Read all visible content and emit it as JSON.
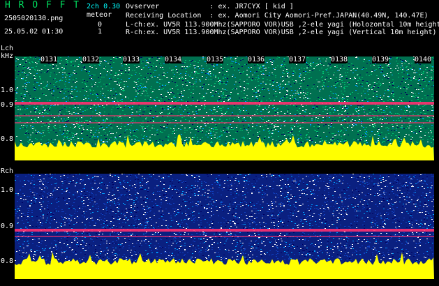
{
  "header": {
    "title": "H R O F F T",
    "channel_mode": "2ch 0.30",
    "meteor_label": "meteor",
    "filename": "2505020130.png",
    "datetime": "25.05.02 01:30",
    "meteor_count_l": "0",
    "meteor_count_r": "1",
    "observer_label": "Ovserver",
    "observer_value": ": ex. JR7CYX [ kid ]",
    "location_label": "Receiving Location",
    "location_value": ": ex. Aomori City Aomori-Pref.JAPAN(40.49N, 140.47E)",
    "lch_line": "L-ch:ex. UV5R 113.900Mhz(SAPPORO VOR)USB ,2-ele yagi (Holozontal 10m height)",
    "rch_line": "R-ch:ex. UV5R 113.900Mhz(SAPPORO VOR)USB ,2-ele yagi (Vertical 10m height)"
  },
  "left_panel": {
    "label": "Lch",
    "unit": "kHz",
    "y_ticks": [
      "1.0",
      "0.9",
      "0.8"
    ],
    "x_ticks": [
      "0131",
      "0132",
      "0133",
      "0134",
      "0135",
      "0136",
      "0137",
      "0138",
      "0139",
      "0140"
    ]
  },
  "right_panel": {
    "label": "Rch",
    "y_ticks": [
      "1.0",
      "0.9",
      "0.8"
    ]
  },
  "colors": {
    "noise_green": "#00c070",
    "noise_blue": "#1040c0",
    "signal_red": "#ff3070",
    "floor_yellow": "#ffff00",
    "header_green": "#00e060",
    "header_cyan": "#00ffff"
  }
}
